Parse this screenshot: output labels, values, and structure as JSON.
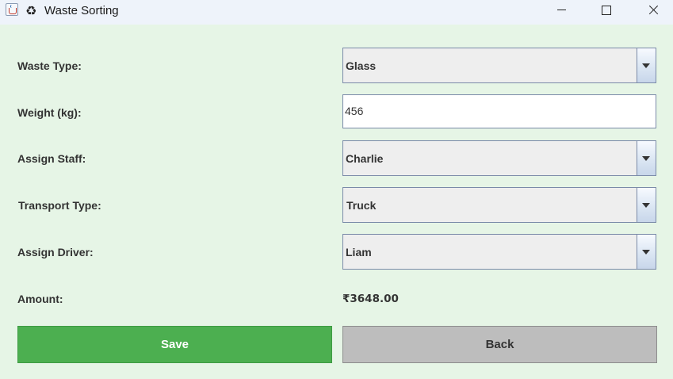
{
  "window": {
    "title": "Waste Sorting",
    "title_icon": "recycle-icon",
    "title_icon_glyph": "♻",
    "controls": [
      "minimize",
      "maximize",
      "close"
    ]
  },
  "form": {
    "waste_type": {
      "label": "Waste Type:",
      "value": "Glass"
    },
    "weight": {
      "label": "Weight (kg):",
      "value": "456"
    },
    "assign_staff": {
      "label": "Assign Staff:",
      "value": "Charlie"
    },
    "transport_type": {
      "label": "Transport Type:",
      "value": "Truck"
    },
    "assign_driver": {
      "label": "Assign Driver:",
      "value": "Liam"
    },
    "amount": {
      "label": "Amount:",
      "value": "₹3648.00"
    }
  },
  "buttons": {
    "save": "Save",
    "back": "Back"
  },
  "colors": {
    "background": "#e6f5e6",
    "save_button": "#4caf50",
    "back_button": "#bdbdbd"
  }
}
